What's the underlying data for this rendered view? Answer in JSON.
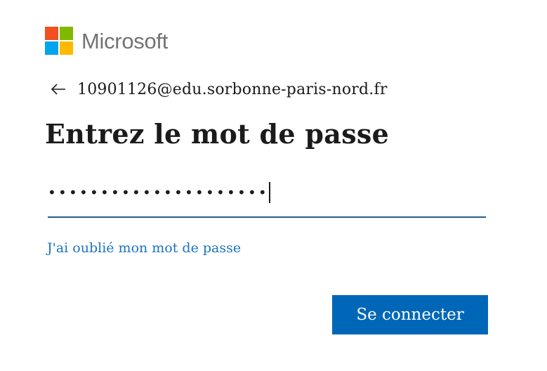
{
  "brand": {
    "name": "Microsoft",
    "logo_colors": [
      "#f25022",
      "#7fba00",
      "#00a4ef",
      "#ffb900"
    ],
    "logo_icon": "microsoft-logo-icon"
  },
  "identity": {
    "back_icon": "arrow-left-icon",
    "email": "10901126@edu.sorbonne-paris-nord.fr"
  },
  "page": {
    "title": "Entrez le mot de passe"
  },
  "password": {
    "masked_value": "•••••••••••••••••••••",
    "underline_color": "#1e5f91"
  },
  "links": {
    "forgot_password": "J'ai oublié mon mot de passe",
    "link_color": "#1a73c0"
  },
  "actions": {
    "signin_label": "Se connecter",
    "button_color": "#0067b8"
  }
}
